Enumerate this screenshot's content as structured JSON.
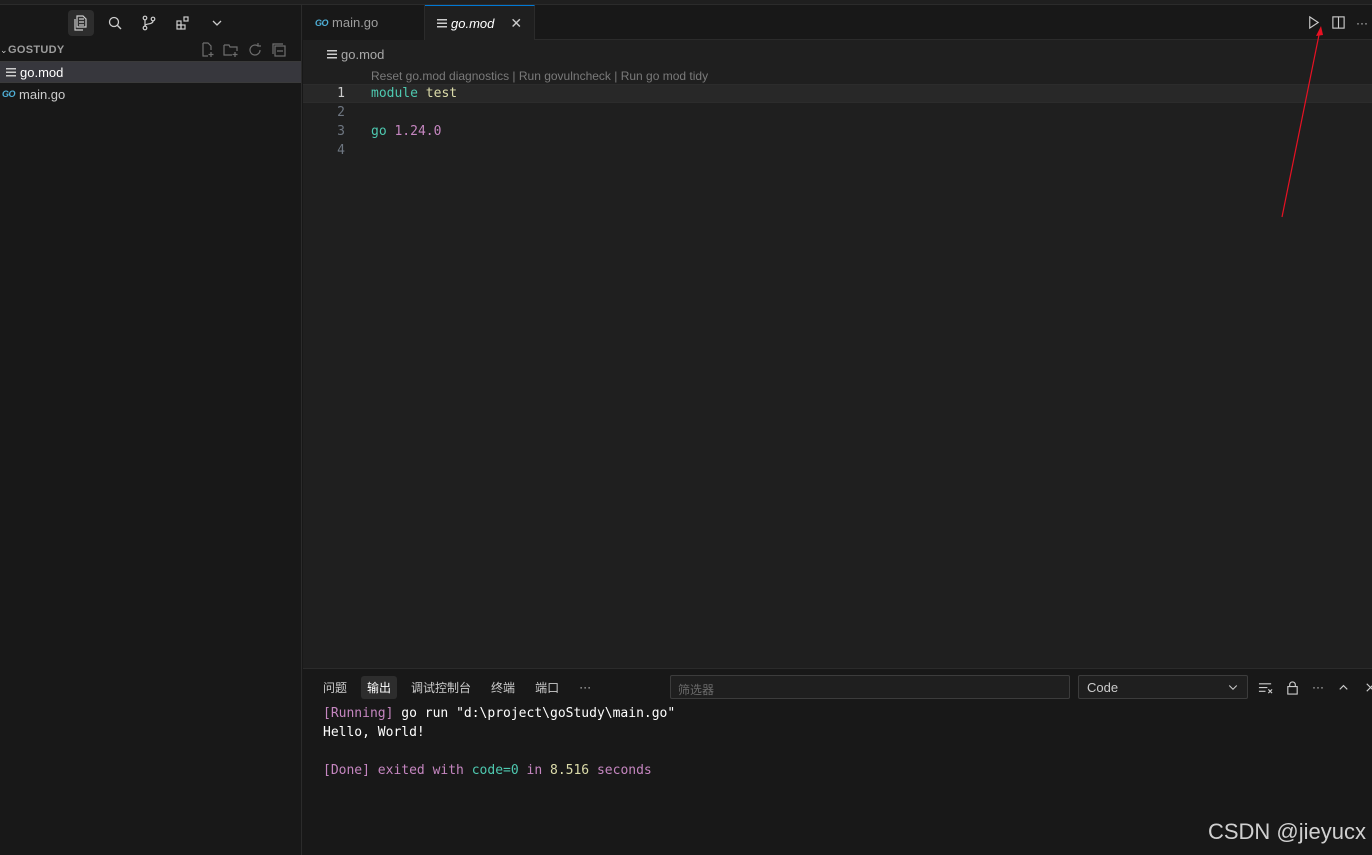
{
  "sidebar": {
    "explorer_title": "GOSTUDY",
    "files": [
      {
        "name": "go.mod",
        "icon": "lines-icon",
        "selected": true
      },
      {
        "name": "main.go",
        "icon": "go-icon",
        "selected": false
      }
    ]
  },
  "editor": {
    "tabs": [
      {
        "label": "main.go",
        "icon_text": "GO",
        "active": false
      },
      {
        "label": "go.mod",
        "active": true,
        "close": "✕"
      }
    ],
    "breadcrumb": "go.mod",
    "codelens": "Reset go.mod diagnostics | Run govulncheck | Run go mod tidy",
    "lines": [
      {
        "number": "1",
        "keyword": "module",
        "rest": "test"
      },
      {
        "number": "2"
      },
      {
        "number": "3",
        "keyword": "go",
        "rest": "1.24.0"
      },
      {
        "number": "4"
      }
    ],
    "more": "···"
  },
  "panel": {
    "tabs": [
      "问题",
      "输出",
      "调试控制台",
      "终端",
      "端口"
    ],
    "more": "···",
    "filter_placeholder": "筛选器",
    "channel": "Code",
    "output": {
      "run_tag": "[Running]",
      "run_cmd": " go run \"d:\\project\\goStudy\\main.go\"",
      "hello": "Hello, World!",
      "done_tag": "[Done]",
      "done_w1": " exited with ",
      "done_code": "code=0",
      "done_w2": " in ",
      "done_time": "8.516",
      "done_w3": " seconds"
    }
  },
  "watermark": "CSDN @jieyucx",
  "colors": {
    "accent": "#0078d4",
    "annotation": "#e81123"
  }
}
